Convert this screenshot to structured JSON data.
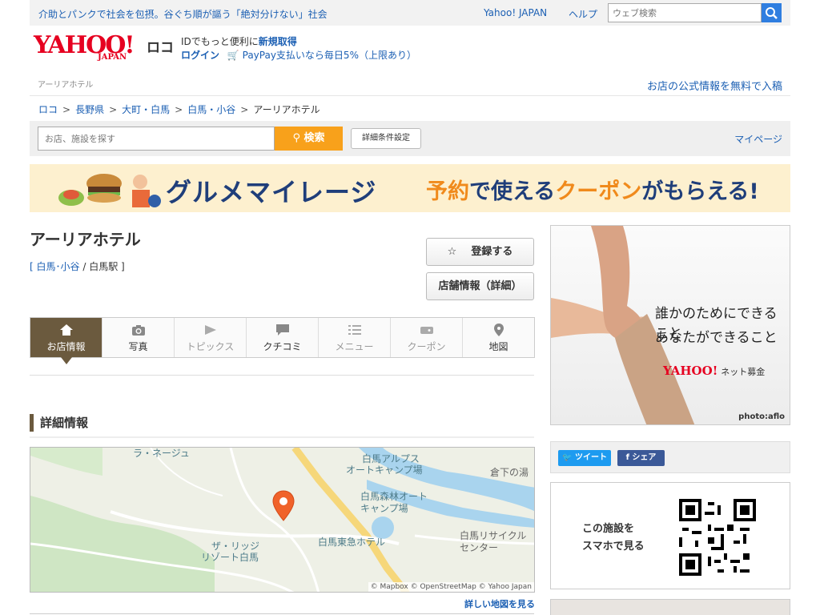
{
  "topbar": {
    "promo": "介助とパンクで社会を包摂。谷ぐち順が謳う「絶対分けない」社会",
    "yahoo_japan": "Yahoo! JAPAN",
    "help": "ヘルプ",
    "search_placeholder": "ウェブ検索"
  },
  "header": {
    "logo_text": "YAHOO!",
    "logo_sub": "JAPAN",
    "service": "ロコ",
    "id_text": "IDでもっと便利に",
    "id_link": "新規取得",
    "login": "ログイン",
    "paypay": "PayPay支払いなら毎日5%（上限あり）"
  },
  "page_label": "アーリアホテル",
  "listing_link": "お店の公式情報を無料で入稿",
  "breadcrumb": [
    "ロコ",
    "長野県",
    "大町・白馬",
    "白馬・小谷",
    "アーリアホテル"
  ],
  "searchbar": {
    "placeholder": "お店、施設を探す",
    "button": "検索",
    "advanced": "詳細条件設定",
    "mypage": "マイページ"
  },
  "banner": {
    "title": "グルメマイレージ",
    "sub_a": "予約",
    "sub_b": "で使える",
    "sub_c": "クーポン",
    "sub_d": "がもらえる!"
  },
  "facility": {
    "name": "アーリアホテル",
    "area": "白馬･小谷",
    "station": "白馬駅",
    "register": "登録する",
    "detail_button": "店舗情報（詳細）"
  },
  "tabs": [
    {
      "label": "お店情報",
      "icon": "home-icon",
      "active": true
    },
    {
      "label": "写真",
      "icon": "camera-icon"
    },
    {
      "label": "トピックス",
      "icon": "video-icon",
      "disabled": true
    },
    {
      "label": "クチコミ",
      "icon": "comment-icon"
    },
    {
      "label": "メニュー",
      "icon": "list-icon",
      "disabled": true
    },
    {
      "label": "クーポン",
      "icon": "coupon-icon",
      "disabled": true
    },
    {
      "label": "地図",
      "icon": "map-pin-icon"
    }
  ],
  "section_title": "詳細情報",
  "map": {
    "labels": {
      "la_neige": "ラ・ネージュ",
      "alps_1": "白馬アルプス",
      "alps_2": "オートキャンプ場",
      "kura": "倉下の湯",
      "forest_1": "白馬森林オート",
      "forest_2": "キャンプ場",
      "tokyu": "白馬東急ホテル",
      "recycle_1": "白馬リサイクル",
      "recycle_2": "センター",
      "ritz_1": "ザ・リッジ",
      "ritz_2": "リゾート白馬"
    },
    "copyright": "© Mapbox © OpenStreetMap © Yahoo Japan",
    "more_link": "詳しい地図を見る"
  },
  "ad": {
    "line1": "誰かのためにできること",
    "line2": "あなたができること",
    "brand": "YAHOO!",
    "brand_sub": "ネット募金",
    "credit": "photo:aflo"
  },
  "share": {
    "tweet": "ツイート",
    "facebook": "シェア"
  },
  "qr": {
    "line1": "この施設を",
    "line2": "スマホで見る"
  },
  "colors": {
    "link": "#1b5fb3",
    "brand_red": "#e60020",
    "search_orange": "#f8a11b",
    "tab_active": "#6b5a3e"
  }
}
